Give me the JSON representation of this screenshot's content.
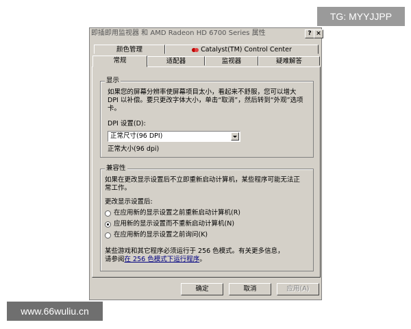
{
  "watermarks": {
    "top_right": "TG: MYYJJPP",
    "bottom_left": "www.66wuliu.cn"
  },
  "dialog": {
    "title": "即插即用监视器 和 AMD Radeon HD 6700 Series 属性",
    "help_button": "?",
    "close_button": "×",
    "tabs_back": [
      {
        "label": "颜色管理"
      },
      {
        "label": "Catalyst(TM) Control Center",
        "icon": "ati-catalyst-icon"
      }
    ],
    "tabs_front": [
      {
        "label": "常规",
        "active": true
      },
      {
        "label": "适配器"
      },
      {
        "label": "监视器"
      },
      {
        "label": "疑难解答"
      }
    ],
    "display_group": {
      "title": "显示",
      "description": "如果您的屏幕分辨率使屏幕项目太小，看起来不舒服，您可以增大 DPI 以补偿。要只更改字体大小，单击“取消”，然后转到“外观”选项卡。",
      "dpi_label": "DPI 设置(D):",
      "dpi_selected": "正常尺寸(96 DPI)",
      "dpi_note": "正常大小(96 dpi)"
    },
    "compat_group": {
      "title": "兼容性",
      "description": "如果在更改显示设置后不立即重新启动计算机，某些程序可能无法正常工作。",
      "after_label": "更改显示设置后:",
      "options": [
        {
          "label": "在应用新的显示设置之前重新启动计算机(R)",
          "checked": false
        },
        {
          "label": "应用新的显示设置而不重新启动计算机(N)",
          "checked": true
        },
        {
          "label": "在应用新的显示设置之前询问(K)",
          "checked": false
        }
      ],
      "footer_text": "某些游戏和其它程序必须运行于 256 色模式。有关更多信息，",
      "footer_prefix": "请参阅",
      "footer_link": "在 256 色模式下运行程序",
      "footer_suffix": "。"
    },
    "buttons": {
      "ok": "确定",
      "cancel": "取消",
      "apply": "应用(A)"
    }
  }
}
